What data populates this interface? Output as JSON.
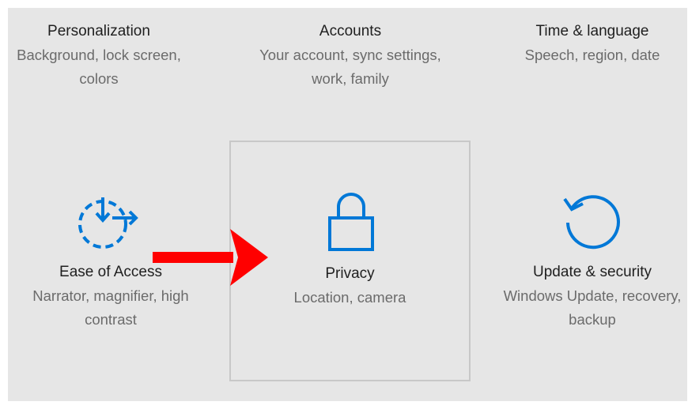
{
  "settings": {
    "tiles": [
      {
        "title": "Personalization",
        "desc": "Background, lock screen, colors"
      },
      {
        "title": "Accounts",
        "desc": "Your account, sync settings, work, family"
      },
      {
        "title": "Time & language",
        "desc": "Speech, region, date"
      },
      {
        "title": "Ease of Access",
        "desc": "Narrator, magnifier, high contrast",
        "icon": "ease-of-access-icon"
      },
      {
        "title": "Privacy",
        "desc": "Location, camera",
        "icon": "lock-icon"
      },
      {
        "title": "Update & security",
        "desc": "Windows Update, recovery, backup",
        "icon": "refresh-icon"
      }
    ]
  },
  "colors": {
    "panel_bg": "#e6e6e6",
    "accent": "#0078d7",
    "annotation": "#ff0000",
    "selected_border": "#c8c8c8"
  }
}
